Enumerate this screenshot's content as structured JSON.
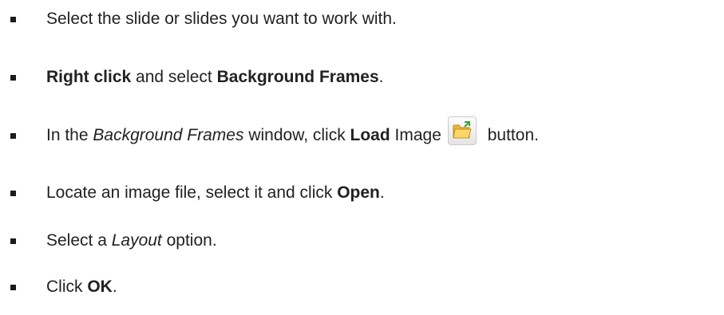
{
  "steps": [
    {
      "text": "Select the slide or slides you want to work with."
    },
    {
      "bold1": "Right click",
      "mid": " and select ",
      "bold2": "Background Frames",
      "end": "."
    },
    {
      "pre": "In the ",
      "italic": "Background Frames",
      "mid": " window, click ",
      "bold": "Load",
      "after_bold": " Image",
      "icon": "folder-open-icon",
      "end": " button."
    },
    {
      "pre": "Locate an image file, select it and click ",
      "bold": "Open",
      "end": "."
    },
    {
      "pre": "Select a ",
      "italic": "Layout",
      "end": " option."
    },
    {
      "pre": "Click ",
      "bold": "OK",
      "end": "."
    }
  ]
}
